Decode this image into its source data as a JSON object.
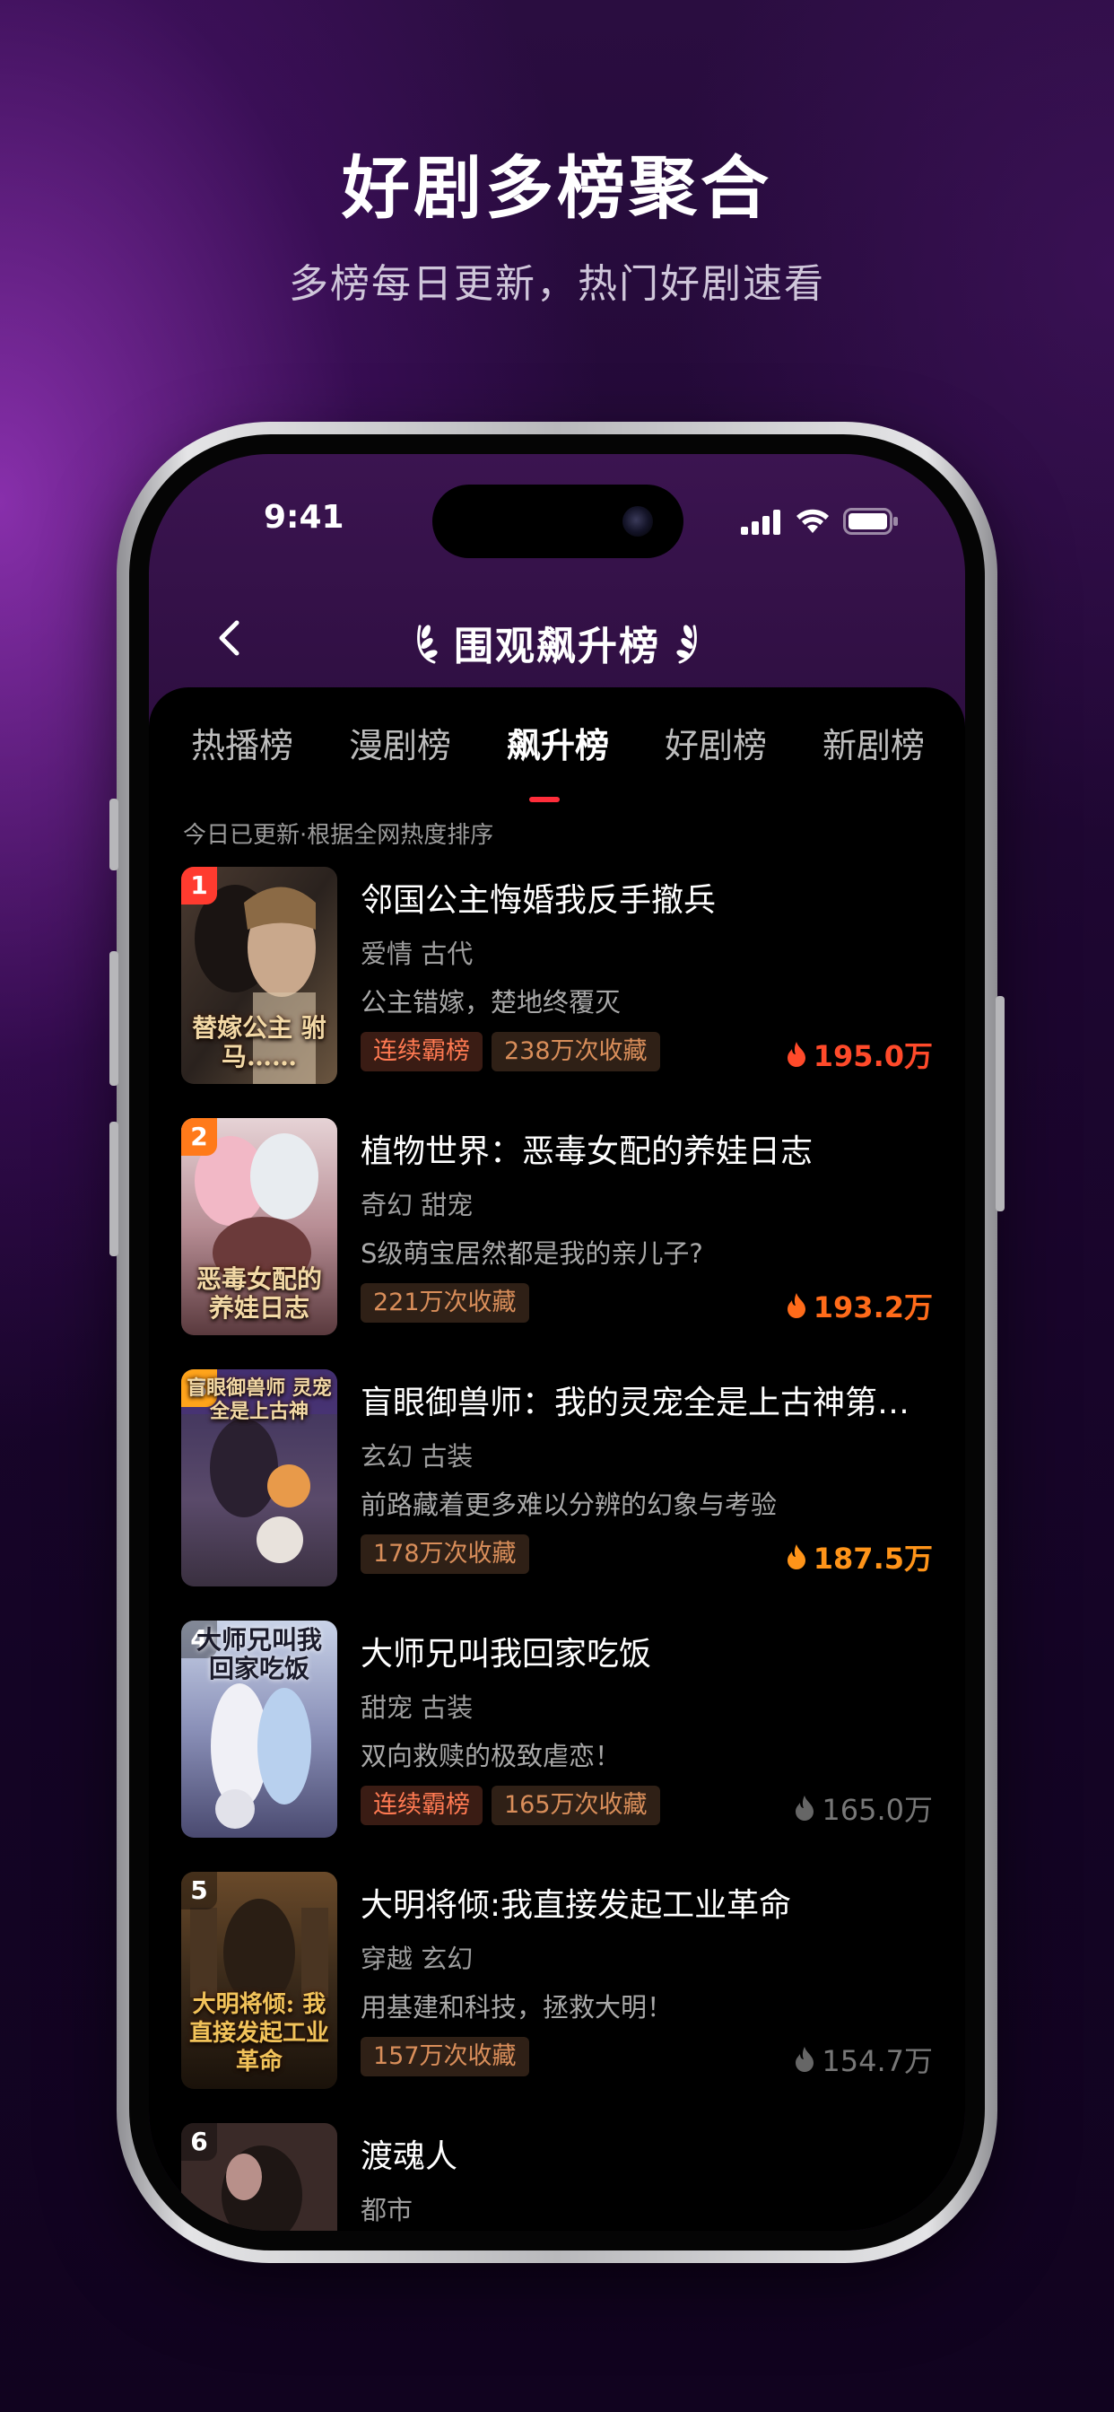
{
  "promo": {
    "title": "好剧多榜聚合",
    "subtitle": "多榜每日更新，热门好剧速看"
  },
  "status_bar": {
    "time": "9:41",
    "icons": [
      "cellular-signal-icon",
      "wifi-icon",
      "battery-icon"
    ]
  },
  "nav": {
    "back_icon": "chevron-left-icon",
    "title": "围观飙升榜",
    "decor_icon": "laurel-icon"
  },
  "tabs": [
    {
      "label": "热播榜",
      "active": false
    },
    {
      "label": "漫剧榜",
      "active": false
    },
    {
      "label": "飙升榜",
      "active": true
    },
    {
      "label": "好剧榜",
      "active": false
    },
    {
      "label": "新剧榜",
      "active": false
    }
  ],
  "update_note": "今日已更新·根据全网热度排序",
  "colors": {
    "accent_red": "#ff2d3a",
    "rank_1": "#ff3b2f",
    "rank_2": "#ff7a1a",
    "rank_3": "#ffa41b",
    "heat_1": "#ff4a2a",
    "heat_2": "#ff6b1a",
    "heat_3": "#ff9419",
    "heat_muted": "#777777"
  },
  "items": [
    {
      "rank": "1",
      "title": "邻国公主悔婚我反手撤兵",
      "genre": "爱情  古代",
      "desc": "公主错嫁，楚地终覆灭",
      "tags": [
        "连续霸榜",
        "238万次收藏"
      ],
      "heat": "195.0万",
      "cover_text": "替嫁公主 驸马……"
    },
    {
      "rank": "2",
      "title": "植物世界：恶毒女配的养娃日志",
      "genre": "奇幻  甜宠",
      "desc": "S级萌宝居然都是我的亲儿子?",
      "tags": [
        "221万次收藏"
      ],
      "heat": "193.2万",
      "cover_text": "恶毒女配的 养娃日志"
    },
    {
      "rank": "3",
      "title": "盲眼御兽师：我的灵宠全是上古神第…",
      "genre": "玄幻  古装",
      "desc": "前路藏着更多难以分辨的幻象与考验",
      "tags": [
        "178万次收藏"
      ],
      "heat": "187.5万",
      "cover_text": "盲眼御兽师 灵宠全是上古神"
    },
    {
      "rank": "4",
      "title": "大师兄叫我回家吃饭",
      "genre": "甜宠  古装",
      "desc": "双向救赎的极致虐恋！",
      "tags": [
        "连续霸榜",
        "165万次收藏"
      ],
      "heat": "165.0万",
      "cover_text": "大师兄叫我 回家吃饭"
    },
    {
      "rank": "5",
      "title": "大明将倾:我直接发起工业革命",
      "genre": "穿越  玄幻",
      "desc": "用基建和科技，拯救大明！",
      "tags": [
        "157万次收藏"
      ],
      "heat": "154.7万",
      "cover_text": "大明将倾: 我直接发起工业革命"
    },
    {
      "rank": "6",
      "title": "渡魂人",
      "genre": "都市",
      "desc": "",
      "tags": [],
      "heat": "",
      "cover_text": ""
    }
  ]
}
